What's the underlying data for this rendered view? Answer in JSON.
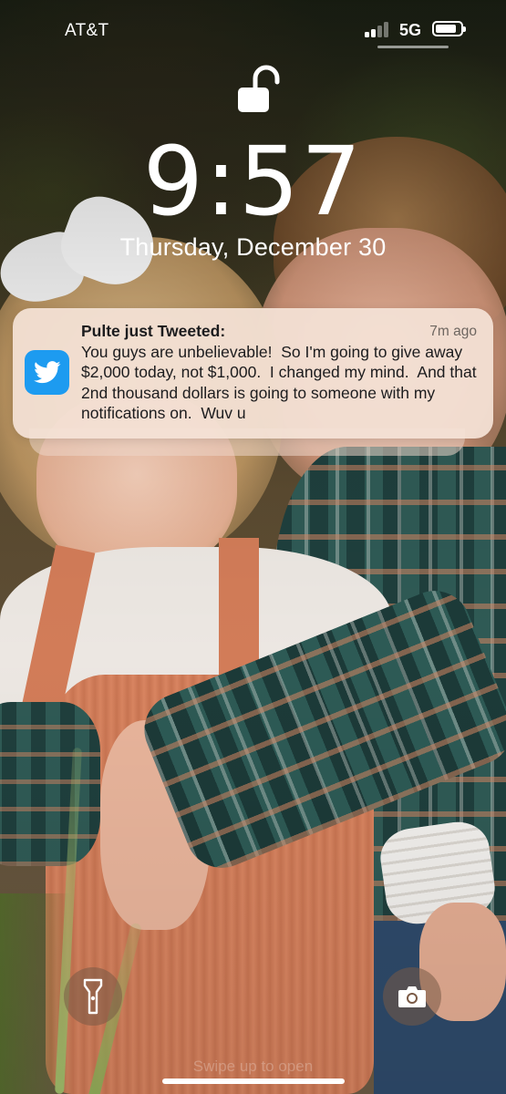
{
  "status_bar": {
    "carrier": "AT&T",
    "network": "5G",
    "signal_bars_active": 2,
    "signal_bars_total": 4,
    "battery_level": 0.85
  },
  "lock_screen": {
    "lock_state": "unlocked",
    "time": "9:57",
    "date": "Thursday, December 30"
  },
  "notification": {
    "app_icon": "twitter-bird-icon",
    "title": "Pulte just Tweeted:",
    "time_ago": "7m ago",
    "body": "You guys are unbelievable!  So I'm going to give away $2,000 today, not $1,000.  I changed my mind.  And that 2nd thousand dollars is going to someone with my notifications on.  Wuv u"
  },
  "bottom": {
    "left_button_icon": "flashlight-icon",
    "right_button_icon": "camera-icon",
    "swipe_hint": "Swipe up to open"
  },
  "colors": {
    "twitter_blue": "#1d9bf0",
    "notification_bg": "#f4e2d6"
  }
}
